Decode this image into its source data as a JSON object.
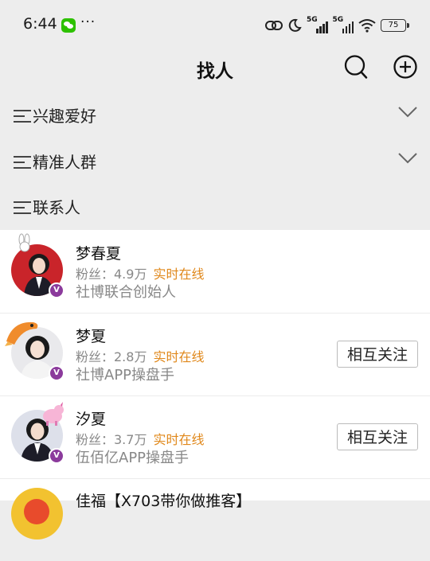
{
  "status_bar": {
    "time": "6:44",
    "dots": "···",
    "network_1": "5G",
    "network_2": "5G",
    "battery": "75"
  },
  "header": {
    "title": "找人"
  },
  "filters": [
    {
      "label": "兴趣爱好"
    },
    {
      "label": "精准人群"
    },
    {
      "label": "联系人"
    }
  ],
  "users": [
    {
      "name": "梦春夏",
      "fans": "粉丝：4.9万",
      "status": "实时在线",
      "desc": "社博联合创始人",
      "button": ""
    },
    {
      "name": "梦夏",
      "fans": "粉丝：2.8万",
      "status": "实时在线",
      "desc": "社博APP操盘手",
      "button": "相互关注"
    },
    {
      "name": "汐夏",
      "fans": "粉丝：3.7万",
      "status": "实时在线",
      "desc": "伍佰亿APP操盘手",
      "button": "相互关注"
    },
    {
      "name": "佳福【X703带你做推客】"
    }
  ],
  "badge_text": "V",
  "colors": {
    "online": "#e0881b",
    "verified_badge": "#8b3a9c",
    "page_bg": "#ededed"
  }
}
